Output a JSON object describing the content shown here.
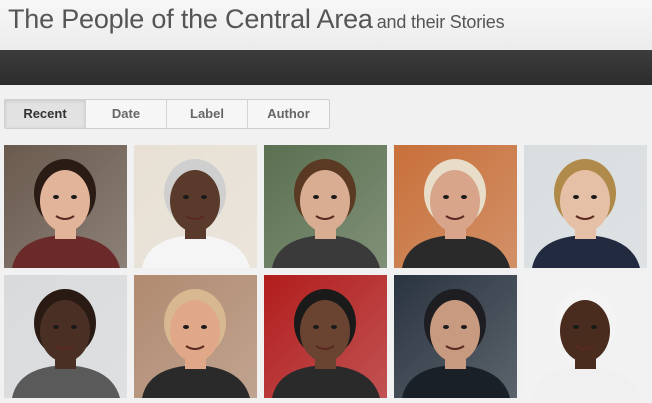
{
  "header": {
    "title": "The People of the Central Area",
    "subtitle": "and their Stories"
  },
  "tabs": [
    {
      "label": "Recent",
      "active": true
    },
    {
      "label": "Date",
      "active": false
    },
    {
      "label": "Label",
      "active": false
    },
    {
      "label": "Author",
      "active": false
    }
  ],
  "portraits": [
    {
      "name": "portrait-woman-glasses-scarf",
      "bg": "#6a5a4e",
      "skin": "#e2b49a",
      "hair": "#2a1b14",
      "shirt": "#6b2a2a"
    },
    {
      "name": "portrait-older-man-white-shirt",
      "bg": "#e8e0d4",
      "skin": "#5a3a2a",
      "hair": "#cfcfcf",
      "shirt": "#f5f5f5"
    },
    {
      "name": "portrait-woman-garden",
      "bg": "#5a7050",
      "skin": "#d9ad92",
      "hair": "#5a3a22",
      "shirt": "#3a3a3a"
    },
    {
      "name": "portrait-older-man-cap",
      "bg": "#c8703a",
      "skin": "#d8a48a",
      "hair": "#e8ddc8",
      "shirt": "#2a2a2a"
    },
    {
      "name": "portrait-woman-blonde",
      "bg": "#d8dde0",
      "skin": "#e6c0a6",
      "hair": "#b08a4a",
      "shirt": "#222a40"
    },
    {
      "name": "portrait-man-window",
      "bg": "#d8dadc",
      "skin": "#4a3024",
      "hair": "#2a1a14",
      "shirt": "#5a5a5a"
    },
    {
      "name": "portrait-man-tan-cap",
      "bg": "#b08a70",
      "skin": "#e0a888",
      "hair": "#d8b890",
      "shirt": "#2a2a2a"
    },
    {
      "name": "portrait-man-red-background",
      "bg": "#b21d1d",
      "skin": "#6a4430",
      "hair": "#1a1a1a",
      "shirt": "#2a2a2a"
    },
    {
      "name": "portrait-older-man-beard-cap",
      "bg": "#2a3440",
      "skin": "#c89a80",
      "hair": "#1e1e22",
      "shirt": "#1a2028"
    },
    {
      "name": "portrait-man-smiling-white-cap",
      "bg": "#f2f2f2",
      "skin": "#4a2c1e",
      "hair": "#f4f4f4",
      "shirt": "#f0f0f0"
    }
  ]
}
